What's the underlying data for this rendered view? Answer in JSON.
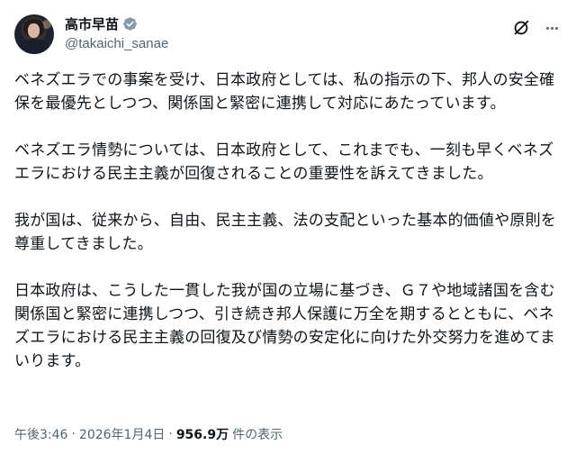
{
  "author": {
    "display_name": "高市早苗",
    "handle": "@takaichi_sanae",
    "verified_color": "#829aab"
  },
  "post": {
    "paragraphs": [
      "ベネズエラでの事案を受け、日本政府としては、私の指示の下、邦人の安全確保を最優先としつつ、関係国と緊密に連携して対応にあたっています。",
      "ベネズエラ情勢については、日本政府として、これまでも、一刻も早くベネズエラにおける民主主義が回復されることの重要性を訴えてきました。",
      "我が国は、従来から、自由、民主主義、法の支配といった基本的価値や原則を尊重してきました。",
      "日本政府は、こうした一貫した我が国の立場に基づき、Ｇ７や地域諸国を含む関係国と緊密に連携しつつ、引き続き邦人保護に万全を期するとともに、ベネズエラにおける民主主義の回復及び情勢の安定化に向けた外交努力を進めてまいります。"
    ]
  },
  "meta": {
    "time": "午後3:46",
    "separator": "·",
    "date": "2026年1月4日",
    "views_count": "956.9万",
    "views_label": "件の表示"
  },
  "icons": {
    "verified": "verified-badge-icon",
    "grok": "grok-icon",
    "more": "more-options-icon"
  }
}
